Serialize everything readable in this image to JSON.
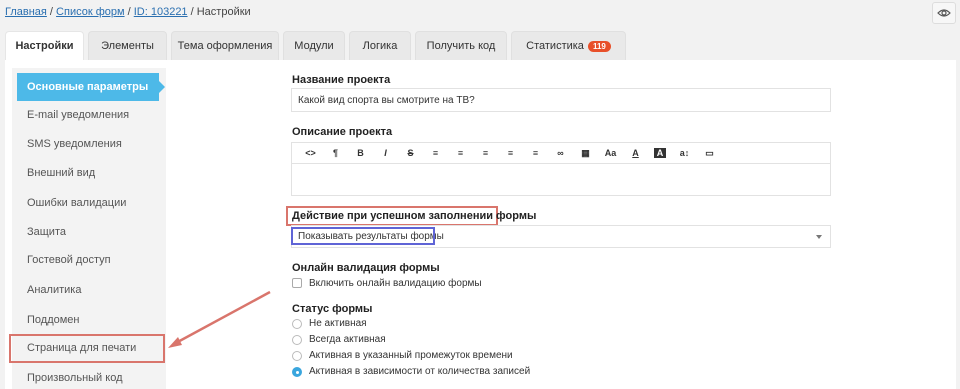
{
  "breadcrumb": {
    "home": "Главная",
    "sep1": " / ",
    "forms": "Список форм",
    "sep2": " / ",
    "id": "ID: 103221",
    "sep3": " / ",
    "current": "Настройки"
  },
  "tabs": [
    {
      "label": "Настройки"
    },
    {
      "label": "Элементы"
    },
    {
      "label": "Тема оформления"
    },
    {
      "label": "Модули"
    },
    {
      "label": "Логика"
    },
    {
      "label": "Получить код"
    },
    {
      "label": "Статистика",
      "badge": "119"
    }
  ],
  "sidebar": {
    "items": [
      {
        "label": "Основные параметры"
      },
      {
        "label": "E-mail уведомления"
      },
      {
        "label": "SMS уведомления"
      },
      {
        "label": "Внешний вид"
      },
      {
        "label": "Ошибки валидации"
      },
      {
        "label": "Защита"
      },
      {
        "label": "Гостевой доступ"
      },
      {
        "label": "Аналитика"
      },
      {
        "label": "Поддомен"
      },
      {
        "label": "Страница для печати"
      },
      {
        "label": "Произвольный код"
      }
    ]
  },
  "form": {
    "project_name_label": "Название проекта",
    "project_name_value": "Какой вид спорта вы смотрите на ТВ?",
    "description_label": "Описание проекта",
    "toolbar": [
      "<>",
      "¶",
      "B",
      "I",
      "S",
      "≡",
      "≡",
      "≡",
      "≡",
      "≡",
      "∞",
      "▦",
      "Aa",
      "A",
      "A",
      "a↕",
      "▭"
    ],
    "success_action_label": "Действие при успешном заполнении формы",
    "success_action_value": "Показывать результаты формы",
    "online_validation_label": "Онлайн валидация формы",
    "online_validation_checkbox": "Включить онлайн валидацию формы",
    "status_label": "Статус формы",
    "status_options": [
      "Не активная",
      "Всегда активная",
      "Активная в указанный промежуток времени",
      "Активная в зависимости от количества записей"
    ],
    "status_selected_index": 3
  },
  "colors": {
    "accent": "#4db9e8",
    "highlight_red": "#d9756c",
    "highlight_blue": "#5f64d6",
    "badge": "#e8502a"
  }
}
